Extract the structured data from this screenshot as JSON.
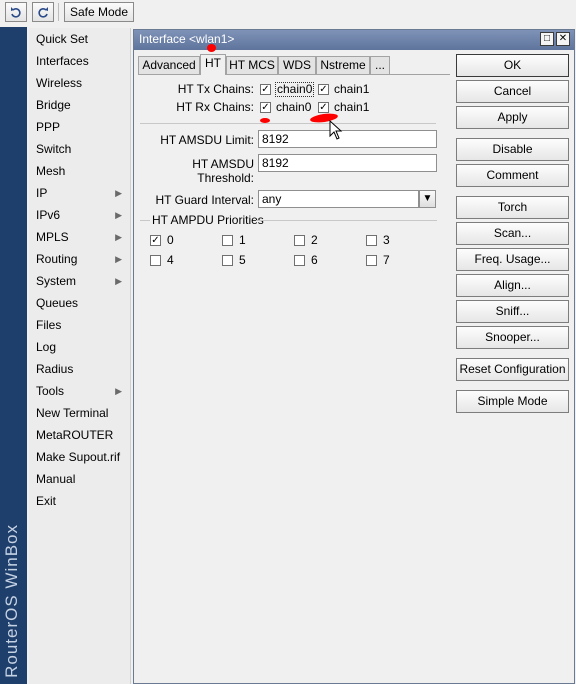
{
  "toolbar": {
    "undo_icon": "undo-icon",
    "redo_icon": "redo-icon",
    "safe_mode_label": "Safe Mode"
  },
  "brand": {
    "text": "RouterOS WinBox"
  },
  "menu": {
    "items": [
      {
        "label": "Quick Set",
        "submenu": false
      },
      {
        "label": "Interfaces",
        "submenu": false
      },
      {
        "label": "Wireless",
        "submenu": false
      },
      {
        "label": "Bridge",
        "submenu": false
      },
      {
        "label": "PPP",
        "submenu": false
      },
      {
        "label": "Switch",
        "submenu": false
      },
      {
        "label": "Mesh",
        "submenu": false
      },
      {
        "label": "IP",
        "submenu": true
      },
      {
        "label": "IPv6",
        "submenu": true
      },
      {
        "label": "MPLS",
        "submenu": true
      },
      {
        "label": "Routing",
        "submenu": true
      },
      {
        "label": "System",
        "submenu": true
      },
      {
        "label": "Queues",
        "submenu": false
      },
      {
        "label": "Files",
        "submenu": false
      },
      {
        "label": "Log",
        "submenu": false
      },
      {
        "label": "Radius",
        "submenu": false
      },
      {
        "label": "Tools",
        "submenu": true
      },
      {
        "label": "New Terminal",
        "submenu": false
      },
      {
        "label": "MetaROUTER",
        "submenu": false
      },
      {
        "label": "Make Supout.rif",
        "submenu": false
      },
      {
        "label": "Manual",
        "submenu": false
      },
      {
        "label": "Exit",
        "submenu": false
      }
    ]
  },
  "window": {
    "title": "Interface <wlan1>",
    "tabs": [
      "Advanced",
      "HT",
      "HT MCS",
      "WDS",
      "Nstreme",
      "..."
    ],
    "active_tab": "HT",
    "ht_tx_chains_label": "HT Tx Chains:",
    "ht_rx_chains_label": "HT Rx Chains:",
    "tx_chains": [
      {
        "label": "chain0",
        "checked": true
      },
      {
        "label": "chain1",
        "checked": true
      }
    ],
    "rx_chains": [
      {
        "label": "chain0",
        "checked": true
      },
      {
        "label": "chain1",
        "checked": true
      }
    ],
    "amsdu_limit_label": "HT AMSDU Limit:",
    "amsdu_limit_value": "8192",
    "amsdu_threshold_label": "HT AMSDU Threshold:",
    "amsdu_threshold_value": "8192",
    "guard_interval_label": "HT Guard Interval:",
    "guard_interval_value": "any",
    "ampdu_priorities_label": "HT AMPDU Priorities",
    "ampdu_priorities": [
      {
        "label": "0",
        "checked": true
      },
      {
        "label": "1",
        "checked": false
      },
      {
        "label": "2",
        "checked": false
      },
      {
        "label": "3",
        "checked": false
      },
      {
        "label": "4",
        "checked": false
      },
      {
        "label": "5",
        "checked": false
      },
      {
        "label": "6",
        "checked": false
      },
      {
        "label": "7",
        "checked": false
      }
    ],
    "buttons": [
      "OK",
      "Cancel",
      "Apply",
      "Disable",
      "Comment",
      "Torch",
      "Scan...",
      "Freq. Usage...",
      "Align...",
      "Sniff...",
      "Snooper...",
      "Reset Configuration",
      "Simple Mode"
    ],
    "check_glyph": "✓"
  }
}
